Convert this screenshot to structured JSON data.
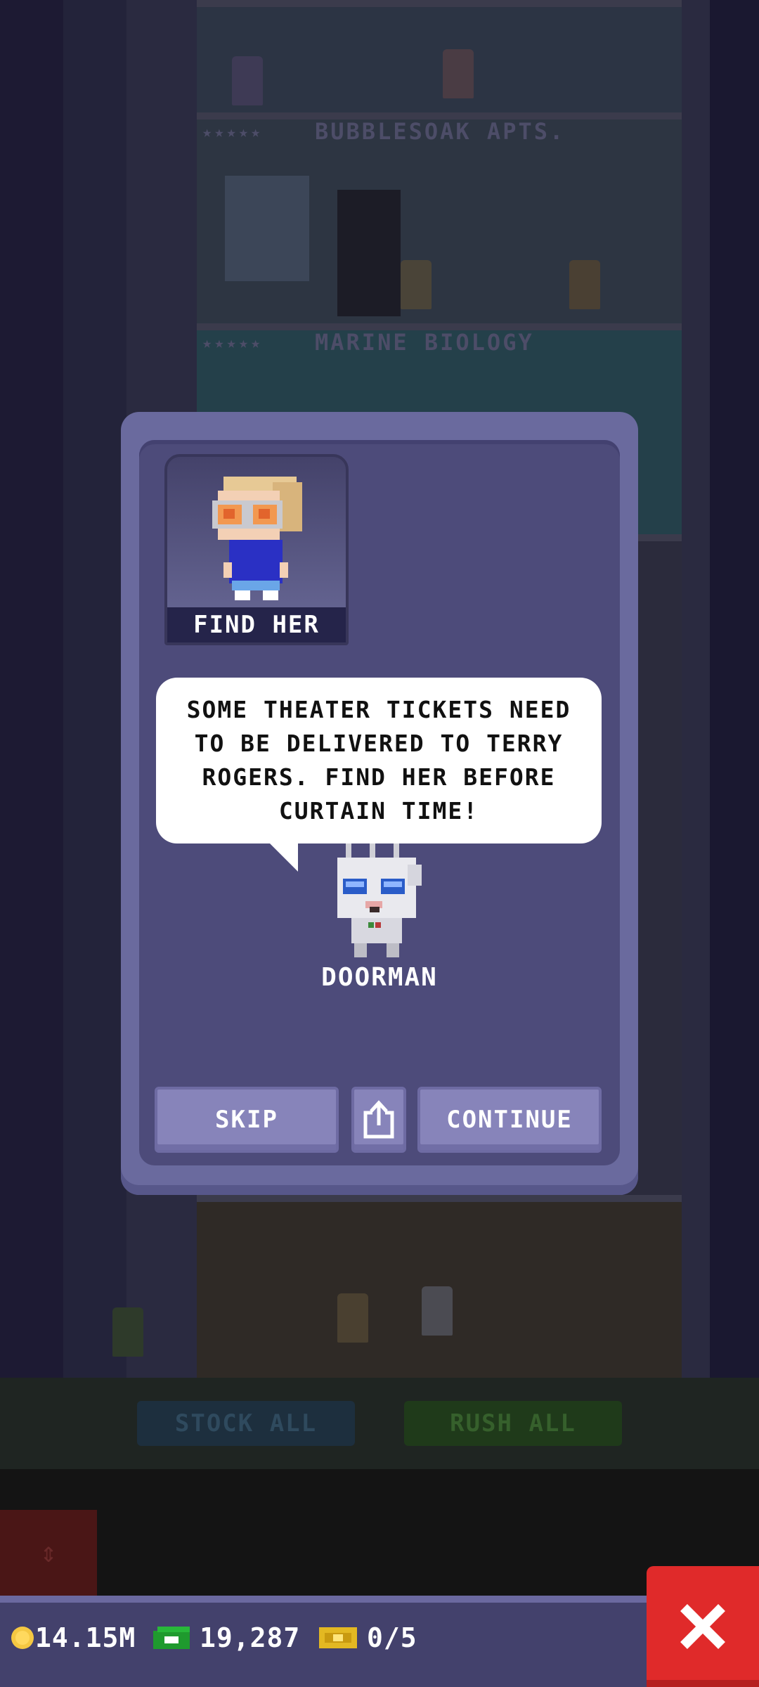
{
  "background": {
    "floors": [
      {
        "label": "BUBBLESOAK APTS.",
        "stars": "★★★★★"
      },
      {
        "label": "MARINE BIOLOGY",
        "stars": "★★★★★"
      }
    ],
    "toolbar": {
      "stock_all": "STOCK ALL",
      "rush_all": "RUSH ALL"
    }
  },
  "dialog": {
    "portrait_caption": "FIND HER",
    "message": "SOME THEATER TICKETS NEED TO BE DELIVERED TO TERRY ROGERS. FIND HER BEFORE CURTAIN TIME!",
    "speaker": "DOORMAN",
    "buttons": {
      "skip": "SKIP",
      "continue": "CONTINUE"
    }
  },
  "hud": {
    "coins": "14.15M",
    "bux": "19,287",
    "tickets": "0/5"
  },
  "colors": {
    "dialog_frame": "#6a6a9e",
    "dialog_inner": "#4d4b7a",
    "button": "#8784ba",
    "close": "#e02a2a",
    "hud": "#43416c"
  },
  "icons": [
    "coin-icon",
    "bux-icon",
    "ticket-icon",
    "share-icon",
    "close-icon",
    "elevator-icon"
  ]
}
